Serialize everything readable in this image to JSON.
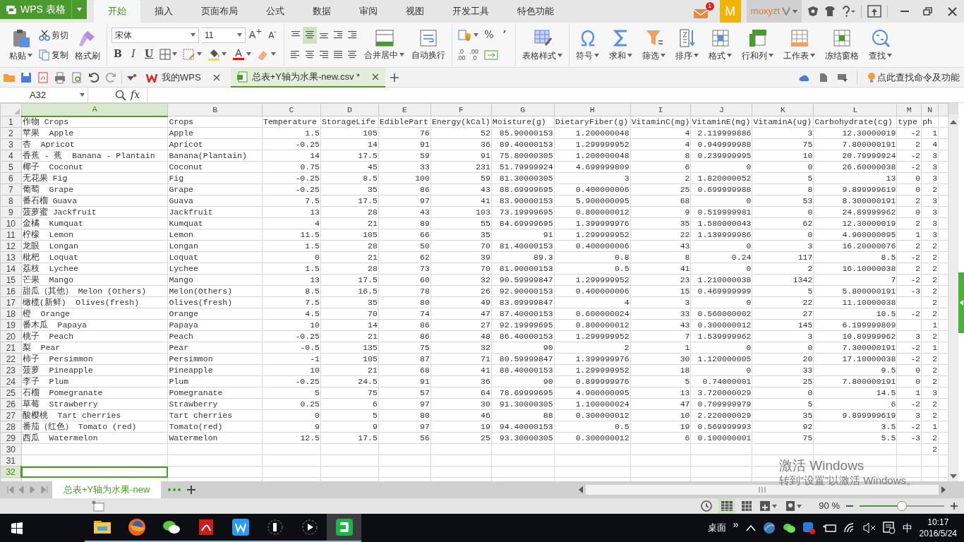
{
  "app_button": {
    "label": "WPS 表格"
  },
  "menu_tabs": [
    {
      "label": "开始",
      "selected": true
    },
    {
      "label": "插入",
      "selected": false
    },
    {
      "label": "页面布局",
      "selected": false
    },
    {
      "label": "公式",
      "selected": false
    },
    {
      "label": "数据",
      "selected": false
    },
    {
      "label": "审阅",
      "selected": false
    },
    {
      "label": "视图",
      "selected": false
    },
    {
      "label": "开发工具",
      "selected": false
    },
    {
      "label": "特色功能",
      "selected": false
    }
  ],
  "account": {
    "mail_badge": "1",
    "avatar_letter": "M",
    "username": "moxyzt"
  },
  "ribbon": {
    "clipboard": {
      "paste": "粘贴",
      "cut": "剪切",
      "copy": "复制",
      "format_painter": "格式刷"
    },
    "font": {
      "name": "宋体",
      "size": "11",
      "grow": "A$^{+}$",
      "shrink": "A$^{-}$",
      "styles": [
        "B",
        "I",
        "U"
      ],
      "font_color": "A"
    },
    "alignment": {
      "buttons": [
        {
          "label": "合并居中",
          "dropdown": true
        },
        {
          "label": "自动换行",
          "dropdown": false
        }
      ]
    },
    "number": {
      "percent": "%",
      "comma": "’",
      "decimals": [
        {
          "top": ".0",
          "bottom": ".00"
        },
        {
          "top": ".00",
          "bottom": ".0"
        }
      ]
    },
    "tools": [
      {
        "label": "表格样式",
        "dropdown": true
      },
      {
        "label": "符号",
        "dropdown": true
      },
      {
        "label": "求和",
        "dropdown": true
      },
      {
        "label": "筛选",
        "dropdown": true
      },
      {
        "label": "排序",
        "dropdown": true
      },
      {
        "label": "格式",
        "dropdown": true
      },
      {
        "label": "行和列",
        "dropdown": true
      },
      {
        "label": "工作表",
        "dropdown": true
      },
      {
        "label": "冻结窗格",
        "dropdown": false
      },
      {
        "label": "查找",
        "dropdown": true
      }
    ]
  },
  "doc_tabs": [
    {
      "label": "我的WPS",
      "selected": false
    },
    {
      "label": "总表+Y轴为水果-new.csv *",
      "selected": true
    }
  ],
  "command_search": "点此查找命令及功能",
  "formula_bar": {
    "name_box": "A32",
    "fx_label": "fx"
  },
  "table": {
    "columns": [
      {
        "letter": "A",
        "numeric": false,
        "selected": true
      },
      {
        "letter": "B",
        "numeric": false,
        "selected": false
      },
      {
        "letter": "C",
        "numeric": true,
        "selected": false
      },
      {
        "letter": "D",
        "numeric": true,
        "selected": false
      },
      {
        "letter": "E",
        "numeric": true,
        "selected": false
      },
      {
        "letter": "F",
        "numeric": true,
        "selected": false
      },
      {
        "letter": "G",
        "numeric": true,
        "selected": false
      },
      {
        "letter": "H",
        "numeric": true,
        "selected": false
      },
      {
        "letter": "I",
        "numeric": true,
        "selected": false
      },
      {
        "letter": "J",
        "numeric": true,
        "selected": false
      },
      {
        "letter": "K",
        "numeric": true,
        "selected": false
      },
      {
        "letter": "L",
        "numeric": true,
        "selected": false
      },
      {
        "letter": "M",
        "numeric": true,
        "selected": false
      },
      {
        "letter": "N",
        "numeric": true,
        "selected": false
      }
    ],
    "rows": [
      {
        "number": "1",
        "kind": "header",
        "selected": false,
        "cells": [
          "作物 Crops",
          "Crops",
          "Temperature",
          "StorageLife",
          "EdiblePart",
          "Energy(kCal)",
          "Moisture(g)",
          "DietaryFiber(g)",
          "VitaminC(mg)",
          "VitaminE(mg)",
          "VitaminA(ug)",
          "Carbohydrate(cg)",
          "type",
          "ph"
        ]
      },
      {
        "number": "2",
        "kind": "data",
        "selected": false,
        "cells": [
          "苹果  Apple",
          "Apple",
          "1.5",
          "105",
          "76",
          "52",
          "85.90000153",
          "1.200000048",
          "4",
          "2.119999886",
          "3",
          "12.30000019",
          "-2",
          "1"
        ]
      },
      {
        "number": "3",
        "kind": "data",
        "selected": false,
        "cells": [
          "杏  Apricot",
          "Apricot",
          "-0.25",
          "14",
          "91",
          "36",
          "89.40000153",
          "1.299999952",
          "4",
          "0.949999988",
          "75",
          "7.800000191",
          "2",
          "4"
        ]
      },
      {
        "number": "4",
        "kind": "data",
        "selected": false,
        "cells": [
          "香蕉 - 蕉  Banana - Plantain",
          "Banana(Plantain)",
          "14",
          "17.5",
          "59",
          "91",
          "75.80000305",
          "1.200000048",
          "8",
          "0.239999995",
          "10",
          "20.79999924",
          "-2",
          "3"
        ]
      },
      {
        "number": "5",
        "kind": "data",
        "selected": false,
        "cells": [
          "椰子  Coconut",
          "Coconut",
          "0.75",
          "45",
          "33",
          "231",
          "51.79999924",
          "4.699999809",
          "6",
          "0",
          "0",
          "26.60000038",
          "-2",
          "3"
        ]
      },
      {
        "number": "6",
        "kind": "data",
        "selected": false,
        "cells": [
          "无花果 Fig",
          "Fig",
          "-0.25",
          "8.5",
          "100",
          "59",
          "81.30000305",
          "3",
          "2",
          "1.820000052",
          "5",
          "13",
          "0",
          "3"
        ]
      },
      {
        "number": "7",
        "kind": "data",
        "selected": false,
        "cells": [
          "葡萄  Grape",
          "Grape",
          "-0.25",
          "35",
          "86",
          "43",
          "88.69999695",
          "0.400000006",
          "25",
          "0.699999988",
          "8",
          "9.899999619",
          "0",
          "2"
        ]
      },
      {
        "number": "8",
        "kind": "data",
        "selected": false,
        "cells": [
          "番石榴 Guava",
          "Guava",
          "7.5",
          "17.5",
          "97",
          "41",
          "83.90000153",
          "5.900000095",
          "68",
          "0",
          "53",
          "8.300000191",
          "2",
          "3"
        ]
      },
      {
        "number": "9",
        "kind": "data",
        "selected": false,
        "cells": [
          "菠萝蜜 Jackfruit",
          "Jackfruit",
          "13",
          "28",
          "43",
          "103",
          "73.19999695",
          "0.800000012",
          "9",
          "0.519999981",
          "0",
          "24.89999962",
          "0",
          "3"
        ]
      },
      {
        "number": "10",
        "kind": "data",
        "selected": false,
        "cells": [
          "金橘  Kumquat",
          "Kumquat",
          "4",
          "21",
          "89",
          "55",
          "84.69999695",
          "1.399999976",
          "35",
          "1.580000043",
          "62",
          "12.30000019",
          "2",
          "3"
        ]
      },
      {
        "number": "11",
        "kind": "data",
        "selected": false,
        "cells": [
          "柠檬  Lemon",
          "Lemon",
          "11.5",
          "105",
          "66",
          "35",
          "91",
          "1.299999952",
          "22",
          "1.139999986",
          "0",
          "4.900000095",
          "1",
          "3"
        ]
      },
      {
        "number": "12",
        "kind": "data",
        "selected": false,
        "cells": [
          "龙眼  Longan",
          "Longan",
          "1.5",
          "28",
          "50",
          "70",
          "81.40000153",
          "0.400000006",
          "43",
          "0",
          "3",
          "16.20000076",
          "2",
          "2"
        ]
      },
      {
        "number": "13",
        "kind": "data",
        "selected": false,
        "cells": [
          "枇杷  Loquat",
          "Loquat",
          "0",
          "21",
          "62",
          "39",
          "89.3",
          "0.8",
          "8",
          "0.24",
          "117",
          "8.5",
          "-2",
          "2"
        ]
      },
      {
        "number": "14",
        "kind": "data",
        "selected": false,
        "cells": [
          "荔枝  Lychee",
          "Lychee",
          "1.5",
          "28",
          "73",
          "70",
          "81.90000153",
          "0.5",
          "41",
          "0",
          "2",
          "16.10000038",
          "2",
          "2"
        ]
      },
      {
        "number": "15",
        "kind": "data",
        "selected": false,
        "cells": [
          "芒果  Mango",
          "Mango",
          "13",
          "17.5",
          "60",
          "32",
          "90.59999847",
          "1.299999952",
          "23",
          "1.210000038",
          "1342",
          "7",
          "-2",
          "2"
        ]
      },
      {
        "number": "16",
        "kind": "data",
        "selected": false,
        "cells": [
          "甜瓜（其他） Melon (Others)",
          "Melon(Others)",
          "8.5",
          "16.5",
          "78",
          "26",
          "92.90000153",
          "0.400000006",
          "15",
          "0.469999999",
          "5",
          "5.800000191",
          "-3",
          "2"
        ]
      },
      {
        "number": "17",
        "kind": "data",
        "selected": false,
        "cells": [
          "橄榄(新鲜)  Olives(fresh)",
          "Olives(fresh)",
          "7.5",
          "35",
          "80",
          "49",
          "83.09999847",
          "4",
          "3",
          "0",
          "22",
          "11.10000038",
          null,
          "2"
        ]
      },
      {
        "number": "18",
        "kind": "data",
        "selected": false,
        "cells": [
          "橙  Orange",
          "Orange",
          "4.5",
          "70",
          "74",
          "47",
          "87.40000153",
          "0.600000024",
          "33",
          "0.560000002",
          "27",
          "10.5",
          "-2",
          "2"
        ]
      },
      {
        "number": "19",
        "kind": "data",
        "selected": false,
        "cells": [
          "番木瓜  Papaya",
          "Papaya",
          "10",
          "14",
          "86",
          "27",
          "92.19999695",
          "0.800000012",
          "43",
          "0.300000012",
          "145",
          "6.199999809",
          null,
          "1"
        ]
      },
      {
        "number": "20",
        "kind": "data",
        "selected": false,
        "cells": [
          "桃子  Peach",
          "Peach",
          "-0.25",
          "21",
          "86",
          "48",
          "86.40000153",
          "1.299999952",
          "7",
          "1.539999962",
          "3",
          "10.89999962",
          "3",
          "2"
        ]
      },
      {
        "number": "21",
        "kind": "data",
        "selected": false,
        "cells": [
          "梨  Pear",
          "Pear",
          "-0.5",
          "135",
          "75",
          "32",
          "90",
          "2",
          "1",
          "0",
          "0",
          "7.300000191",
          "-2",
          "1"
        ]
      },
      {
        "number": "22",
        "kind": "data",
        "selected": false,
        "cells": [
          "柿子  Persimmon",
          "Persimmon",
          "-1",
          "105",
          "87",
          "71",
          "80.59999847",
          "1.399999976",
          "30",
          "1.120000005",
          "20",
          "17.10000038",
          "-2",
          "2"
        ]
      },
      {
        "number": "23",
        "kind": "data",
        "selected": false,
        "cells": [
          "菠萝  Pineapple",
          "Pineapple",
          "10",
          "21",
          "68",
          "41",
          "88.40000153",
          "1.299999952",
          "18",
          "0",
          "33",
          "9.5",
          "0",
          "2"
        ]
      },
      {
        "number": "24",
        "kind": "data",
        "selected": false,
        "cells": [
          "李子  Plum",
          "Plum",
          "-0.25",
          "24.5",
          "91",
          "36",
          "90",
          "0.899999976",
          "5",
          "0.74000001",
          "25",
          "7.800000191",
          "0",
          "2"
        ]
      },
      {
        "number": "25",
        "kind": "data",
        "selected": false,
        "cells": [
          "石榴  Pomegranate",
          "Pomegranate",
          "5",
          "75",
          "57",
          "64",
          "78.69999695",
          "4.900000095",
          "13",
          "3.720000029",
          "0",
          "14.5",
          "1",
          "3"
        ]
      },
      {
        "number": "26",
        "kind": "data",
        "selected": false,
        "cells": [
          "草莓  Strawberry",
          "Strawberry",
          "0.25",
          "6",
          "97",
          "30",
          "91.30000305",
          "1.100000024",
          "47",
          "0.709999979",
          "5",
          "6",
          "-2",
          "2"
        ]
      },
      {
        "number": "27",
        "kind": "data",
        "selected": false,
        "cells": [
          "酸樱桃  Tart cherries",
          "Tart cherries",
          "0",
          "5",
          "80",
          "46",
          "88",
          "0.300000012",
          "10",
          "2.220000029",
          "35",
          "9.899999619",
          "3",
          "2"
        ]
      },
      {
        "number": "28",
        "kind": "data",
        "selected": false,
        "cells": [
          "番茄（红色） Tomato (red)",
          "Tomato(red)",
          "9",
          "9",
          "97",
          "19",
          "94.40000153",
          "0.5",
          "19",
          "0.569999993",
          "92",
          "3.5",
          "-2",
          "1"
        ]
      },
      {
        "number": "29",
        "kind": "data",
        "selected": false,
        "cells": [
          "西瓜  Watermelon",
          "Watermelon",
          "12.5",
          "17.5",
          "56",
          "25",
          "93.30000305",
          "0.300000012",
          "6",
          "0.100000001",
          "75",
          "5.5",
          "-3",
          "2"
        ]
      },
      {
        "number": "30",
        "kind": "data",
        "selected": false,
        "cells": [
          null,
          null,
          null,
          null,
          null,
          null,
          null,
          null,
          null,
          null,
          null,
          null,
          null,
          "2"
        ]
      },
      {
        "number": "31",
        "kind": "data",
        "selected": false,
        "cells": []
      },
      {
        "number": "32",
        "kind": "data",
        "selected": true,
        "cells": []
      }
    ]
  },
  "activation_notice": {
    "title": "激活 Windows",
    "detail": "转到“设置”以激活 Windows。"
  },
  "sheet_tabs": [
    {
      "label": "总表+Y轴为水果-new",
      "selected": true
    }
  ],
  "status_bar": {
    "zoom": "90 %",
    "zoom_slider": {
      "level": 0.5
    }
  },
  "taskbar": {
    "apps": [
      {
        "active": false
      },
      {
        "active": false
      },
      {
        "active": false
      },
      {
        "active": false
      },
      {
        "active": false
      },
      {
        "active": false
      },
      {
        "active": false
      },
      {
        "active": true
      }
    ],
    "desktop_label": "桌面",
    "chevron": "»",
    "ime": "中",
    "time": "10:17",
    "date": "2016/5/24"
  }
}
